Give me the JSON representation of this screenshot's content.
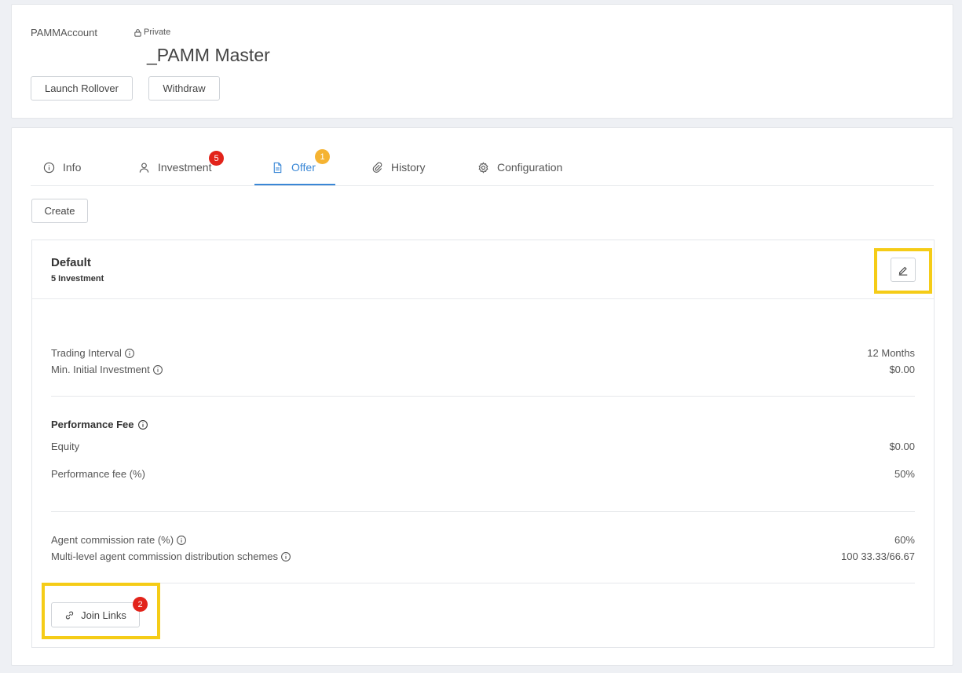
{
  "header": {
    "account_type": "PAMMAccount",
    "privacy": "Private",
    "account_name": "_PAMM Master",
    "buttons": {
      "rollover": "Launch Rollover",
      "withdraw": "Withdraw"
    }
  },
  "tabs": [
    {
      "label": "Info",
      "icon": "info-icon"
    },
    {
      "label": "Investment",
      "icon": "user-icon",
      "badge": "5",
      "badge_color": "#e2231a"
    },
    {
      "label": "Offer",
      "icon": "document-icon",
      "badge": "1",
      "badge_color": "#f5b332",
      "active": true
    },
    {
      "label": "History",
      "icon": "paperclip-icon"
    },
    {
      "label": "Configuration",
      "icon": "gear-icon"
    }
  ],
  "create_label": "Create",
  "offer": {
    "title": "Default",
    "subtitle": "5 Investment",
    "rows_basic": [
      {
        "label": "Trading Interval",
        "value": "12 Months"
      },
      {
        "label": "Min. Initial Investment",
        "value": "$0.00"
      }
    ],
    "performance_title": "Performance Fee",
    "rows_fee": [
      {
        "label": "Equity",
        "value": "$0.00"
      },
      {
        "label": "Performance fee (%)",
        "value": "50%"
      }
    ],
    "rows_agent": [
      {
        "label": "Agent commission rate (%)",
        "value": "60%"
      },
      {
        "label": "Multi-level agent commission distribution schemes",
        "value": "100 33.33/66.67"
      }
    ],
    "join_label": "Join Links",
    "join_badge": "2"
  },
  "colors": {
    "accent": "#3a87d6",
    "highlight": "#f5cc17",
    "badge_red": "#e2231a",
    "badge_orange": "#f5b332"
  }
}
